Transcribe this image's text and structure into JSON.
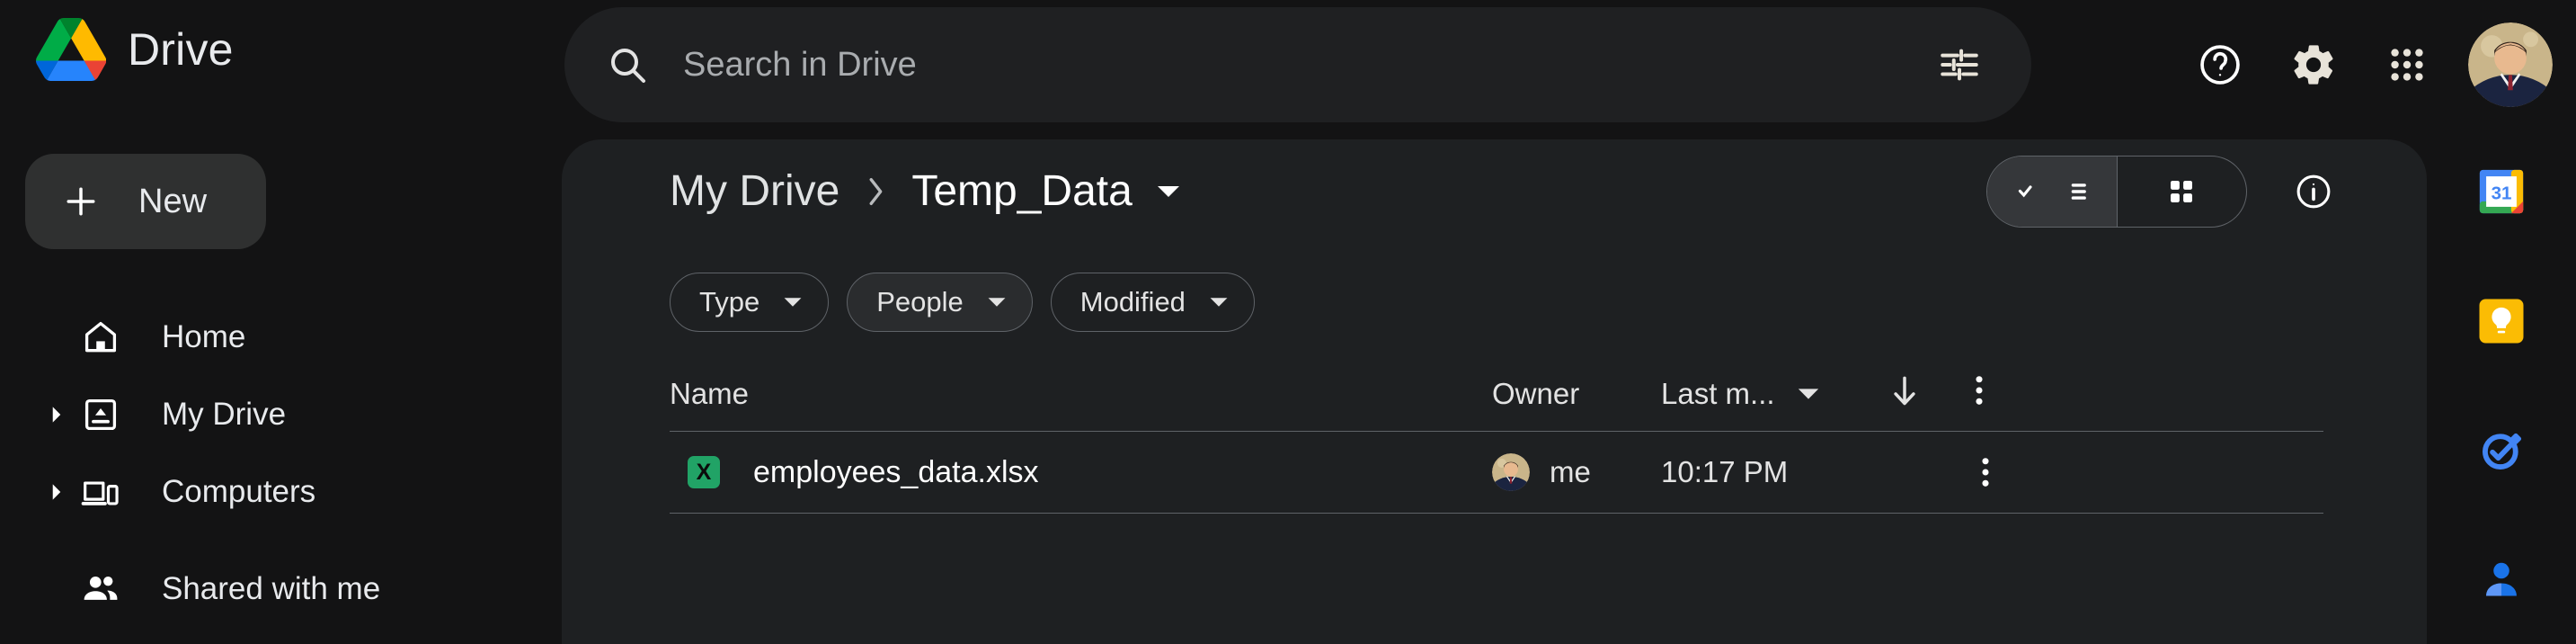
{
  "app": {
    "brand_name": "Drive",
    "logo_icon": "google-drive-logo"
  },
  "search": {
    "placeholder": "Search in Drive",
    "value": "",
    "search_icon": "search-icon",
    "tune_icon": "tune-filter-icon"
  },
  "topbar_actions": [
    {
      "name": "help",
      "icon": "help-circle-icon",
      "label": "Support"
    },
    {
      "name": "settings",
      "icon": "gear-icon",
      "label": "Settings"
    },
    {
      "name": "apps",
      "icon": "apps-grid-icon",
      "label": "Google apps"
    },
    {
      "name": "account",
      "icon": "avatar",
      "label": "Google Account"
    }
  ],
  "sidebar": {
    "new_button": {
      "label": "New",
      "icon": "plus-icon"
    },
    "items": [
      {
        "label": "Home",
        "icon": "home-icon",
        "expandable": false
      },
      {
        "label": "My Drive",
        "icon": "my-drive-icon",
        "expandable": true
      },
      {
        "label": "Computers",
        "icon": "computers-icon",
        "expandable": true
      },
      {
        "label": "Shared with me",
        "icon": "people-icon",
        "expandable": false
      }
    ]
  },
  "breadcrumb": {
    "parent": "My Drive",
    "separator": "›",
    "current": "Temp_Data",
    "caret_icon": "chevron-down-icon"
  },
  "view_toggle": {
    "list_label": "List view",
    "grid_label": "Grid view",
    "active": "list",
    "list_icon": "list-check-icon",
    "grid_icon": "grid-view-icon"
  },
  "details_button": {
    "label": "View details",
    "icon": "info-circle-icon"
  },
  "filters": [
    {
      "label": "Type",
      "caret_icon": "chevron-down-icon",
      "hovered": false
    },
    {
      "label": "People",
      "caret_icon": "chevron-down-icon",
      "hovered": true
    },
    {
      "label": "Modified",
      "caret_icon": "chevron-down-icon",
      "hovered": false
    }
  ],
  "table": {
    "columns": {
      "name": "Name",
      "owner": "Owner",
      "last_modified": "Last m...",
      "sort_caret_icon": "caret-down-icon",
      "sort_direction_icon": "arrow-down-icon",
      "more_icon": "more-vertical-icon"
    },
    "rows": [
      {
        "name": "employees_data.xlsx",
        "file_type_icon": "xlsx-file-icon",
        "file_type_letter": "X",
        "owner": "me",
        "owner_avatar": "avatar",
        "last_modified": "10:17 PM",
        "more_icon": "more-vertical-icon"
      }
    ]
  },
  "right_rail": [
    {
      "name": "google-calendar",
      "icon": "calendar-icon",
      "label": "Calendar",
      "day": "31"
    },
    {
      "name": "google-keep",
      "icon": "keep-bulb-icon",
      "label": "Keep"
    },
    {
      "name": "google-tasks",
      "icon": "tasks-check-icon",
      "label": "Tasks"
    },
    {
      "name": "google-contacts",
      "icon": "contacts-person-icon",
      "label": "Contacts"
    }
  ],
  "colors": {
    "page_background": "#131314",
    "content_background": "#1e2022",
    "search_background": "#1f2022",
    "new_button_background": "#2f3030",
    "text_primary": "#e8eaed",
    "text_secondary": "#e3e3e3",
    "divider": "#5f6368",
    "xlsx_green": "#21a366",
    "drive_green": "#34a853",
    "drive_yellow": "#fbbc04",
    "drive_blue": "#4285f4",
    "drive_red": "#ea4335"
  }
}
